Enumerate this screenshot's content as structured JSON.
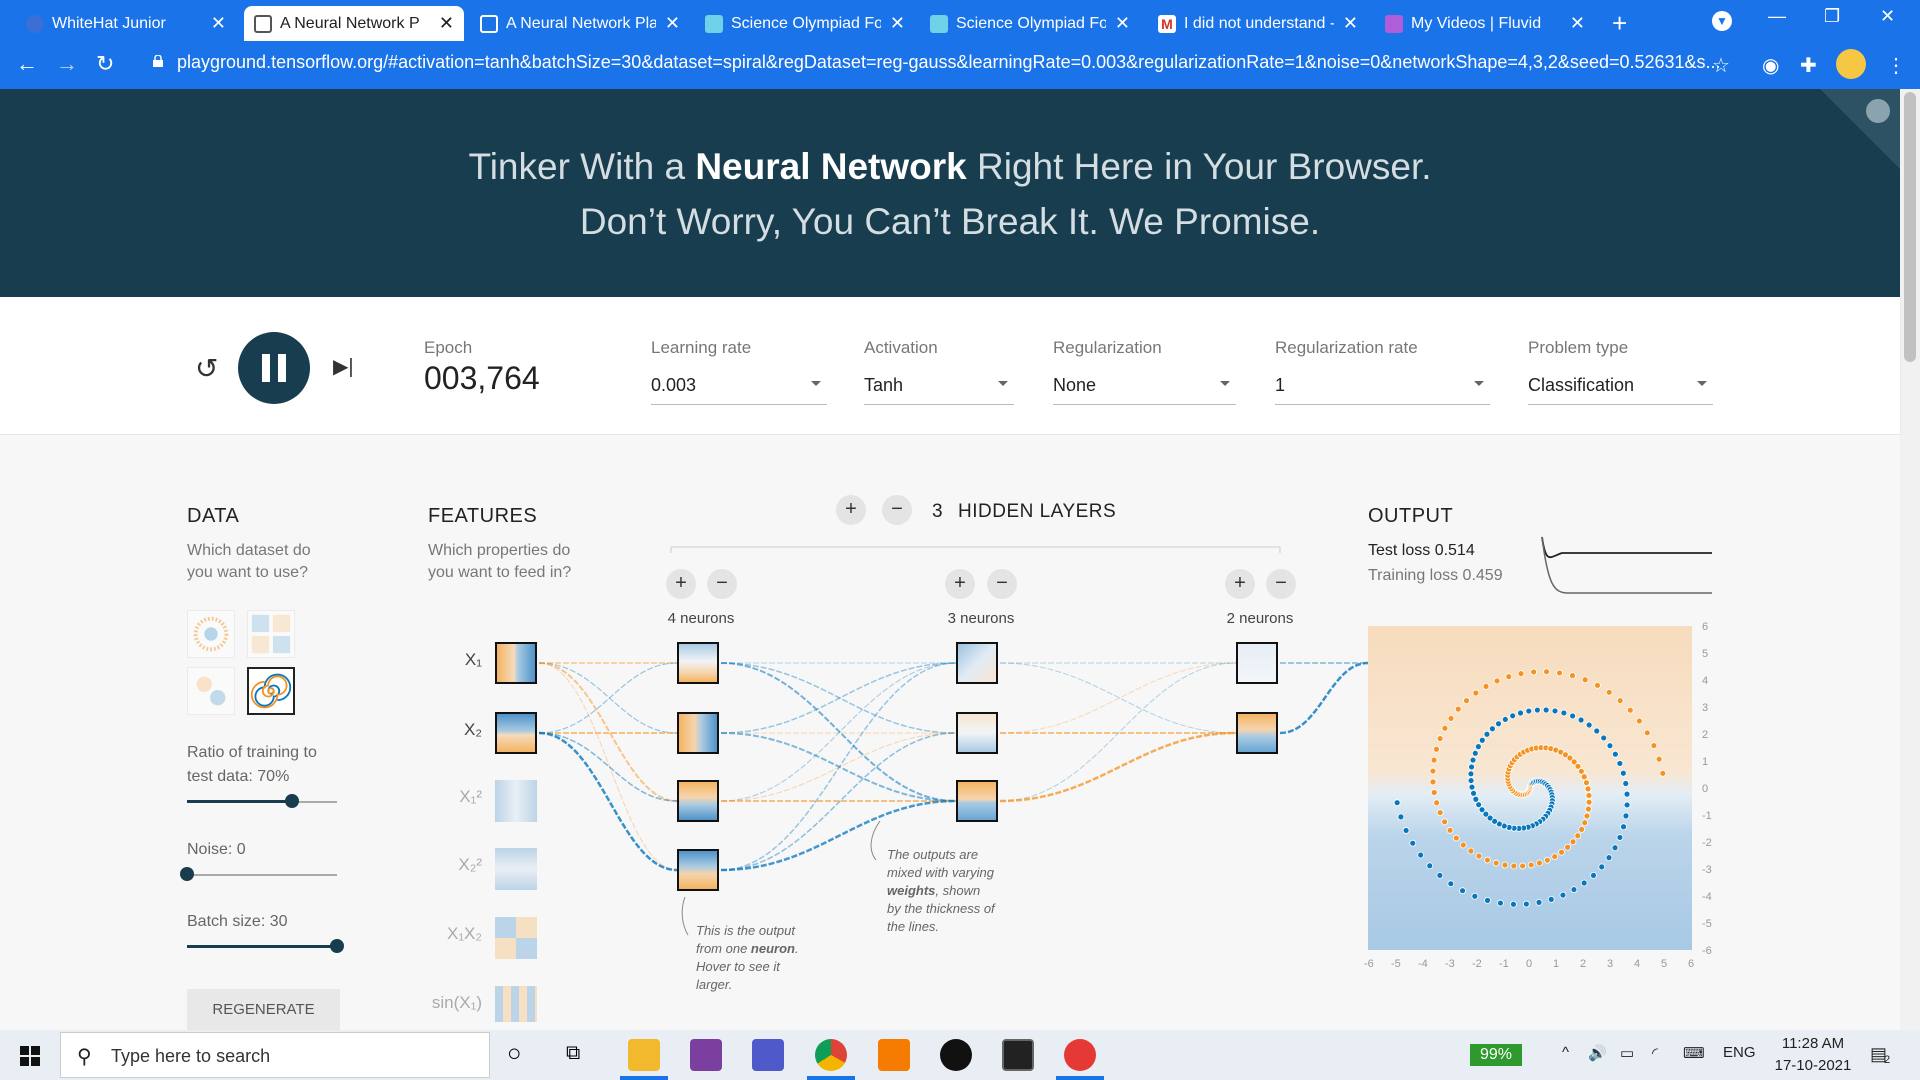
{
  "browser": {
    "tabs": [
      {
        "title": "WhiteHat Junior",
        "icon": "whitehat-favicon"
      },
      {
        "title": "A Neural Network Pla",
        "icon": "tensorflow-favicon",
        "active": true
      },
      {
        "title": "A Neural Network Pla",
        "icon": "tensorflow-favicon"
      },
      {
        "title": "Science Olympiad Fou",
        "icon": "sof-favicon"
      },
      {
        "title": "Science Olympiad Fou",
        "icon": "sof-favicon"
      },
      {
        "title": "I did not understand -",
        "icon": "gmail-favicon"
      },
      {
        "title": "My Videos | Fluvid",
        "icon": "fluvid-favicon"
      }
    ],
    "url": "playground.tensorflow.org/#activation=tanh&batchSize=30&dataset=spiral&regDataset=reg-gauss&learningRate=0.003&regularizationRate=1&noise=0&networkShape=4,3,2&seed=0.52631&s...",
    "accent": "#1a73e8"
  },
  "header": {
    "line1_pre": "Tinker With a ",
    "line1_bold": "Neural Network",
    "line1_post": " Right Here in Your Browser.",
    "line2": "Don’t Worry, You Can’t Break It. We Promise.",
    "bg": "#183d4e"
  },
  "controls": {
    "epoch_label": "Epoch",
    "epoch_value": "003,764",
    "learning_rate": {
      "label": "Learning rate",
      "value": "0.003"
    },
    "activation": {
      "label": "Activation",
      "value": "Tanh"
    },
    "regularization": {
      "label": "Regularization",
      "value": "None"
    },
    "regularization_rate": {
      "label": "Regularization rate",
      "value": "1"
    },
    "problem_type": {
      "label": "Problem type",
      "value": "Classification"
    }
  },
  "data": {
    "title": "DATA",
    "subtitle_1": "Which dataset do",
    "subtitle_2": "you want to use?",
    "ratio_label_1": "Ratio of training to",
    "ratio_label_2": "test data:  70%",
    "ratio": 0.7,
    "noise_label": "Noise:  0",
    "noise": 0,
    "batch_label": "Batch size:  30",
    "batch": 30,
    "regenerate": "REGENERATE"
  },
  "features": {
    "title": "FEATURES",
    "subtitle_1": "Which properties do",
    "subtitle_2": "you want to feed in?",
    "items": [
      {
        "label": "X₁",
        "active": true
      },
      {
        "label": "X₂",
        "active": true
      },
      {
        "label": "X₁²",
        "active": false
      },
      {
        "label": "X₂²",
        "active": false
      },
      {
        "label": "X₁X₂",
        "active": false
      },
      {
        "label": "sin(X₁)",
        "active": false
      }
    ]
  },
  "network": {
    "hidden_count": "3",
    "hidden_label": "HIDDEN LAYERS",
    "layers": [
      {
        "neurons_label": "4 neurons"
      },
      {
        "neurons_label": "3 neurons"
      },
      {
        "neurons_label": "2 neurons"
      }
    ],
    "annotation_neuron": [
      "This is the output",
      "from one ",
      "neuron",
      ".",
      "Hover to see it",
      "larger."
    ],
    "annotation_weights": [
      "The outputs are",
      "mixed with varying",
      "weights",
      ", shown",
      "by the thickness of",
      "the lines."
    ]
  },
  "output": {
    "title": "OUTPUT",
    "test_loss": "Test loss 0.514",
    "training_loss": "Training loss 0.459",
    "y_ticks": [
      "6",
      "5",
      "4",
      "3",
      "2",
      "1",
      "0",
      "-1",
      "-2",
      "-3",
      "-4",
      "-5",
      "-6"
    ],
    "x_ticks": [
      "-6",
      "-5",
      "-4",
      "-3",
      "-2",
      "-1",
      "0",
      "1",
      "2",
      "3",
      "4",
      "5",
      "6"
    ],
    "colors": {
      "orange": "#f59322",
      "blue": "#0877bd"
    }
  },
  "taskbar": {
    "search_placeholder": "Type here to search",
    "battery": "99%",
    "lang": "ENG",
    "time": "11:28 AM",
    "date": "17-10-2021",
    "notifications": "2"
  }
}
